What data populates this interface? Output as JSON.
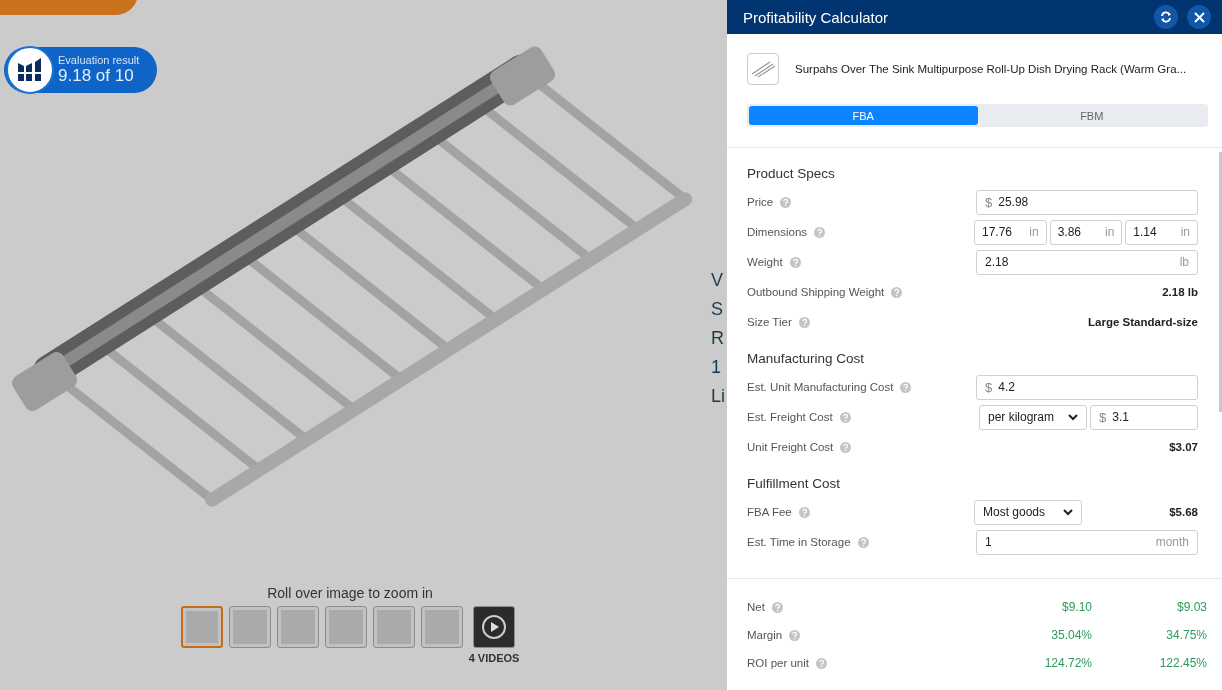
{
  "background_page": {
    "rating_badge": {
      "label": "Evaluation result",
      "score": "9.18 of 10"
    },
    "zoom_hint": "Roll over image to zoom in",
    "thumbnails": [
      {
        "kind": "image",
        "selected": true
      },
      {
        "kind": "image",
        "selected": false
      },
      {
        "kind": "image",
        "selected": false
      },
      {
        "kind": "image",
        "selected": false
      },
      {
        "kind": "image",
        "selected": false
      },
      {
        "kind": "image",
        "selected": false
      },
      {
        "kind": "video",
        "selected": false
      }
    ],
    "videos_label": "4 VIDEOS",
    "cut_text": [
      "V",
      "S",
      "R",
      "1",
      "Li"
    ]
  },
  "calculator": {
    "title": "Profitability Calculator",
    "product_title": "Surpahs Over The Sink Multipurpose Roll-Up Dish Drying Rack (Warm Gra...",
    "tabs": [
      {
        "label": "FBA",
        "selected": true
      },
      {
        "label": "FBM",
        "selected": false
      }
    ],
    "sections": [
      {
        "title": "Product Specs",
        "rows": [
          {
            "label": "Price",
            "kind": "money",
            "currency": "$",
            "value": "25.98"
          },
          {
            "label": "Dimensions",
            "kind": "dimensions",
            "fields": [
              {
                "value": "17.76",
                "unit": "in"
              },
              {
                "value": "3.86",
                "unit": "in"
              },
              {
                "value": "1.14",
                "unit": "in"
              }
            ]
          },
          {
            "label": "Weight",
            "kind": "unit",
            "value": "2.18",
            "unit": "lb"
          },
          {
            "label": "Outbound Shipping Weight",
            "kind": "text",
            "value": "2.18 lb"
          },
          {
            "label": "Size Tier",
            "kind": "text",
            "value": "Large Standard-size"
          }
        ]
      },
      {
        "title": "Manufacturing Cost",
        "rows": [
          {
            "label": "Est. Unit Manufacturing Cost",
            "kind": "money",
            "currency": "$",
            "value": "4.2"
          },
          {
            "label": "Est. Freight Cost",
            "kind": "select_money",
            "option": "per kilogram",
            "currency": "$",
            "value": "3.1"
          },
          {
            "label": "Unit Freight Cost",
            "kind": "text",
            "value": "$3.07"
          }
        ]
      },
      {
        "title": "Fulfillment Cost",
        "rows": [
          {
            "label": "FBA Fee",
            "kind": "select_text",
            "option": "Most goods",
            "value": "$5.68"
          },
          {
            "label": "Est. Time in Storage",
            "kind": "unit",
            "value": "1",
            "unit": "month"
          }
        ]
      }
    ],
    "summary": [
      {
        "label": "Net",
        "values": [
          "$9.10",
          "$9.03"
        ]
      },
      {
        "label": "Margin",
        "values": [
          "35.04%",
          "34.75%"
        ]
      },
      {
        "label": "ROI per unit",
        "values": [
          "124.72%",
          "122.45%"
        ]
      }
    ]
  }
}
